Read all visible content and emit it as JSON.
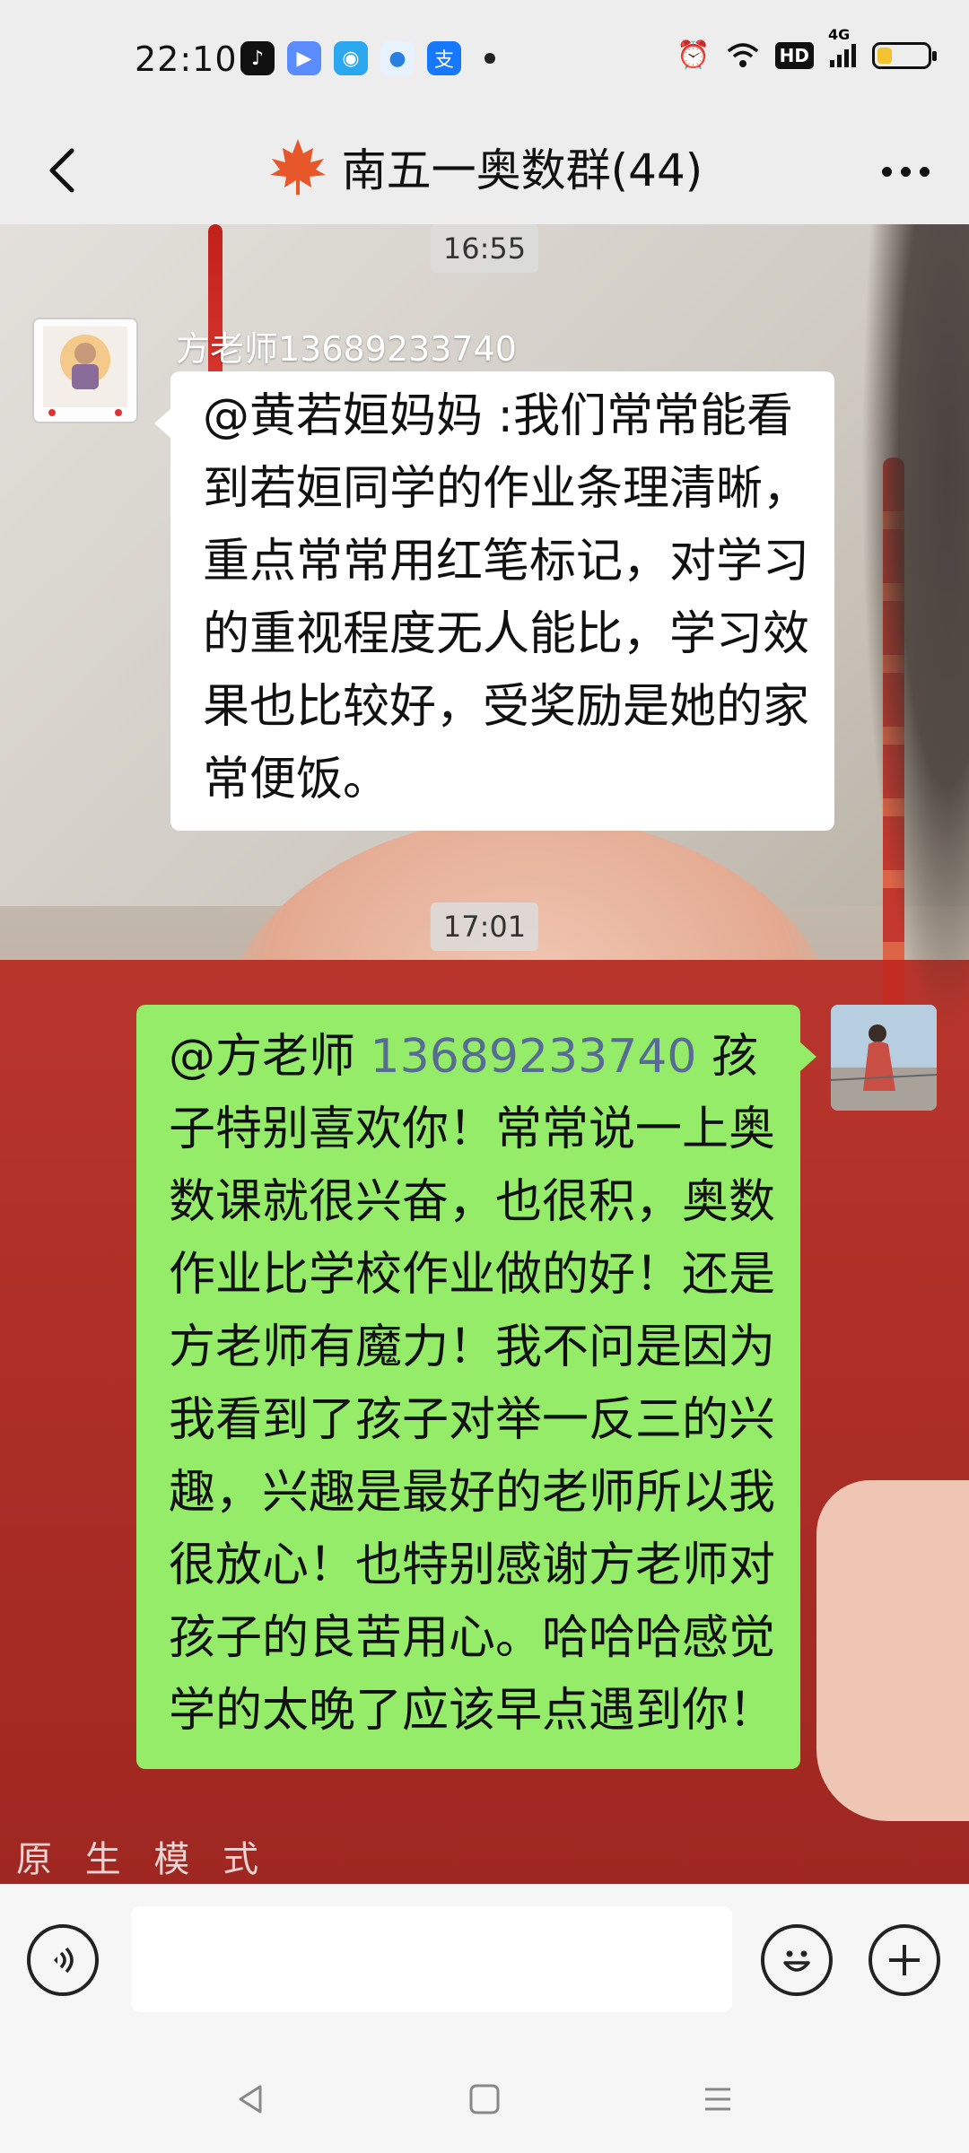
{
  "status_bar": {
    "time": "22:10",
    "apps": [
      "tiktok-icon",
      "video-app-icon",
      "qq-icon",
      "browser-icon",
      "alipay-icon"
    ],
    "network": "4G",
    "hd_label": "HD",
    "battery_level": 0.3
  },
  "header": {
    "title": "南五一奥数群(44)",
    "back_icon": "chevron-left-icon",
    "more_icon": "more-dots-icon",
    "group_icon": "maple-leaf-icon"
  },
  "chat": {
    "messages": [
      {
        "time": "16:55",
        "sender": "方老师13689233740",
        "text": "@黄若姮妈妈 :我们常常能看到若姮同学的作业条理清晰，重点常常用红笔标记，对学习的重视程度无人能比，学习效果也比较好，受奖励是她的家常便饭。"
      },
      {
        "time": "17:01",
        "mention_prefix": "@方老师 ",
        "mention_number": "13689233740",
        "text": " 孩子特别喜欢你！常常说一上奥数课就很兴奋，也很积，奥数作业比学校作业做的好！还是方老师有魔力！我不问是因为我看到了孩子对举一反三的兴趣，兴趣是最好的老师所以我很放心！也特别感谢方老师对孩子的良苦用心。哈哈哈感觉学的太晚了应该早点遇到你！"
      }
    ],
    "watermark": "原 生 模 式"
  },
  "input_bar": {
    "placeholder": "",
    "voice_icon": "voice-icon",
    "emoji_icon": "emoji-icon",
    "plus_icon": "plus-icon"
  },
  "nav_bar": {
    "icons": [
      "nav-back-icon",
      "nav-home-icon",
      "nav-menu-icon"
    ]
  },
  "colors": {
    "self_bubble": "#95ec69",
    "other_bubble": "#ffffff",
    "link_blue": "#576b95",
    "bar_bg": "#ededed"
  }
}
